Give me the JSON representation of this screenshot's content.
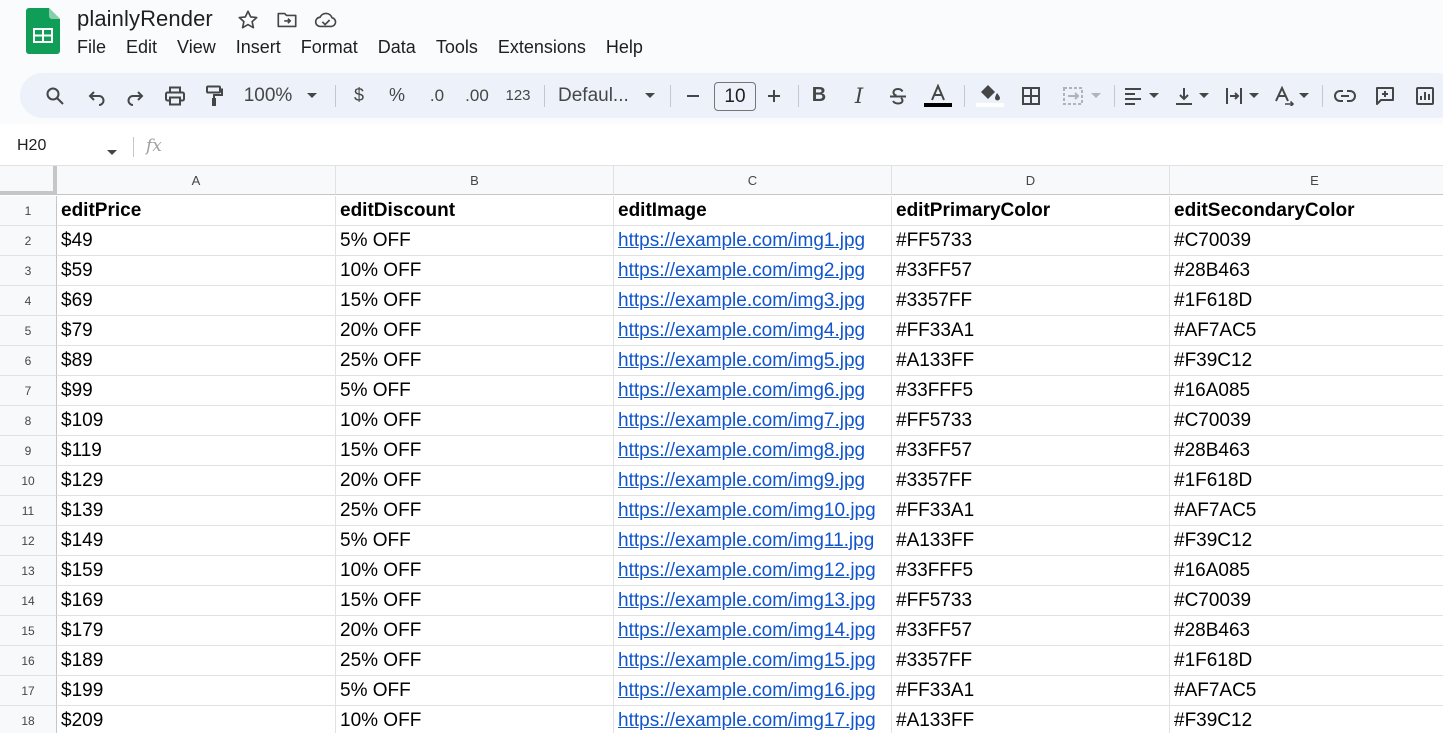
{
  "header": {
    "doc_title": "plainlyRender",
    "menu": [
      "File",
      "Edit",
      "View",
      "Insert",
      "Format",
      "Data",
      "Tools",
      "Extensions",
      "Help"
    ]
  },
  "toolbar": {
    "zoom": "100%",
    "currency": "$",
    "percent": "%",
    "decrease_decimal": ".0",
    "increase_decimal": ".00",
    "number_format": "123",
    "font": "Defaul...",
    "font_size": "10",
    "text_color": "#000000"
  },
  "formula_bar": {
    "name_box": "H20",
    "fx": "fx"
  },
  "sheet": {
    "columns": [
      "A",
      "B",
      "C",
      "D",
      "E"
    ],
    "rows": [
      [
        "editPrice",
        "editDiscount",
        "editImage",
        "editPrimaryColor",
        "editSecondaryColor"
      ],
      [
        "$49",
        "5% OFF",
        "https://example.com/img1.jpg",
        "#FF5733",
        "#C70039"
      ],
      [
        "$59",
        "10% OFF",
        "https://example.com/img2.jpg",
        "#33FF57",
        "#28B463"
      ],
      [
        "$69",
        "15% OFF",
        "https://example.com/img3.jpg",
        "#3357FF",
        "#1F618D"
      ],
      [
        "$79",
        "20% OFF",
        "https://example.com/img4.jpg",
        "#FF33A1",
        "#AF7AC5"
      ],
      [
        "$89",
        "25% OFF",
        "https://example.com/img5.jpg",
        "#A133FF",
        "#F39C12"
      ],
      [
        "$99",
        "5% OFF",
        "https://example.com/img6.jpg",
        "#33FFF5",
        "#16A085"
      ],
      [
        "$109",
        "10% OFF",
        "https://example.com/img7.jpg",
        "#FF5733",
        "#C70039"
      ],
      [
        "$119",
        "15% OFF",
        "https://example.com/img8.jpg",
        "#33FF57",
        "#28B463"
      ],
      [
        "$129",
        "20% OFF",
        "https://example.com/img9.jpg",
        "#3357FF",
        "#1F618D"
      ],
      [
        "$139",
        "25% OFF",
        "https://example.com/img10.jpg",
        "#FF33A1",
        "#AF7AC5"
      ],
      [
        "$149",
        "5% OFF",
        "https://example.com/img11.jpg",
        "#A133FF",
        "#F39C12"
      ],
      [
        "$159",
        "10% OFF",
        "https://example.com/img12.jpg",
        "#33FFF5",
        "#16A085"
      ],
      [
        "$169",
        "15% OFF",
        "https://example.com/img13.jpg",
        "#FF5733",
        "#C70039"
      ],
      [
        "$179",
        "20% OFF",
        "https://example.com/img14.jpg",
        "#33FF57",
        "#28B463"
      ],
      [
        "$189",
        "25% OFF",
        "https://example.com/img15.jpg",
        "#3357FF",
        "#1F618D"
      ],
      [
        "$199",
        "5% OFF",
        "https://example.com/img16.jpg",
        "#FF33A1",
        "#AF7AC5"
      ],
      [
        "$209",
        "10% OFF",
        "https://example.com/img17.jpg",
        "#A133FF",
        "#F39C12"
      ]
    ]
  },
  "colors": {
    "link": "#1155cc",
    "sheets_green": "#0f9d58",
    "toolbar_bg": "#edf2fa"
  }
}
